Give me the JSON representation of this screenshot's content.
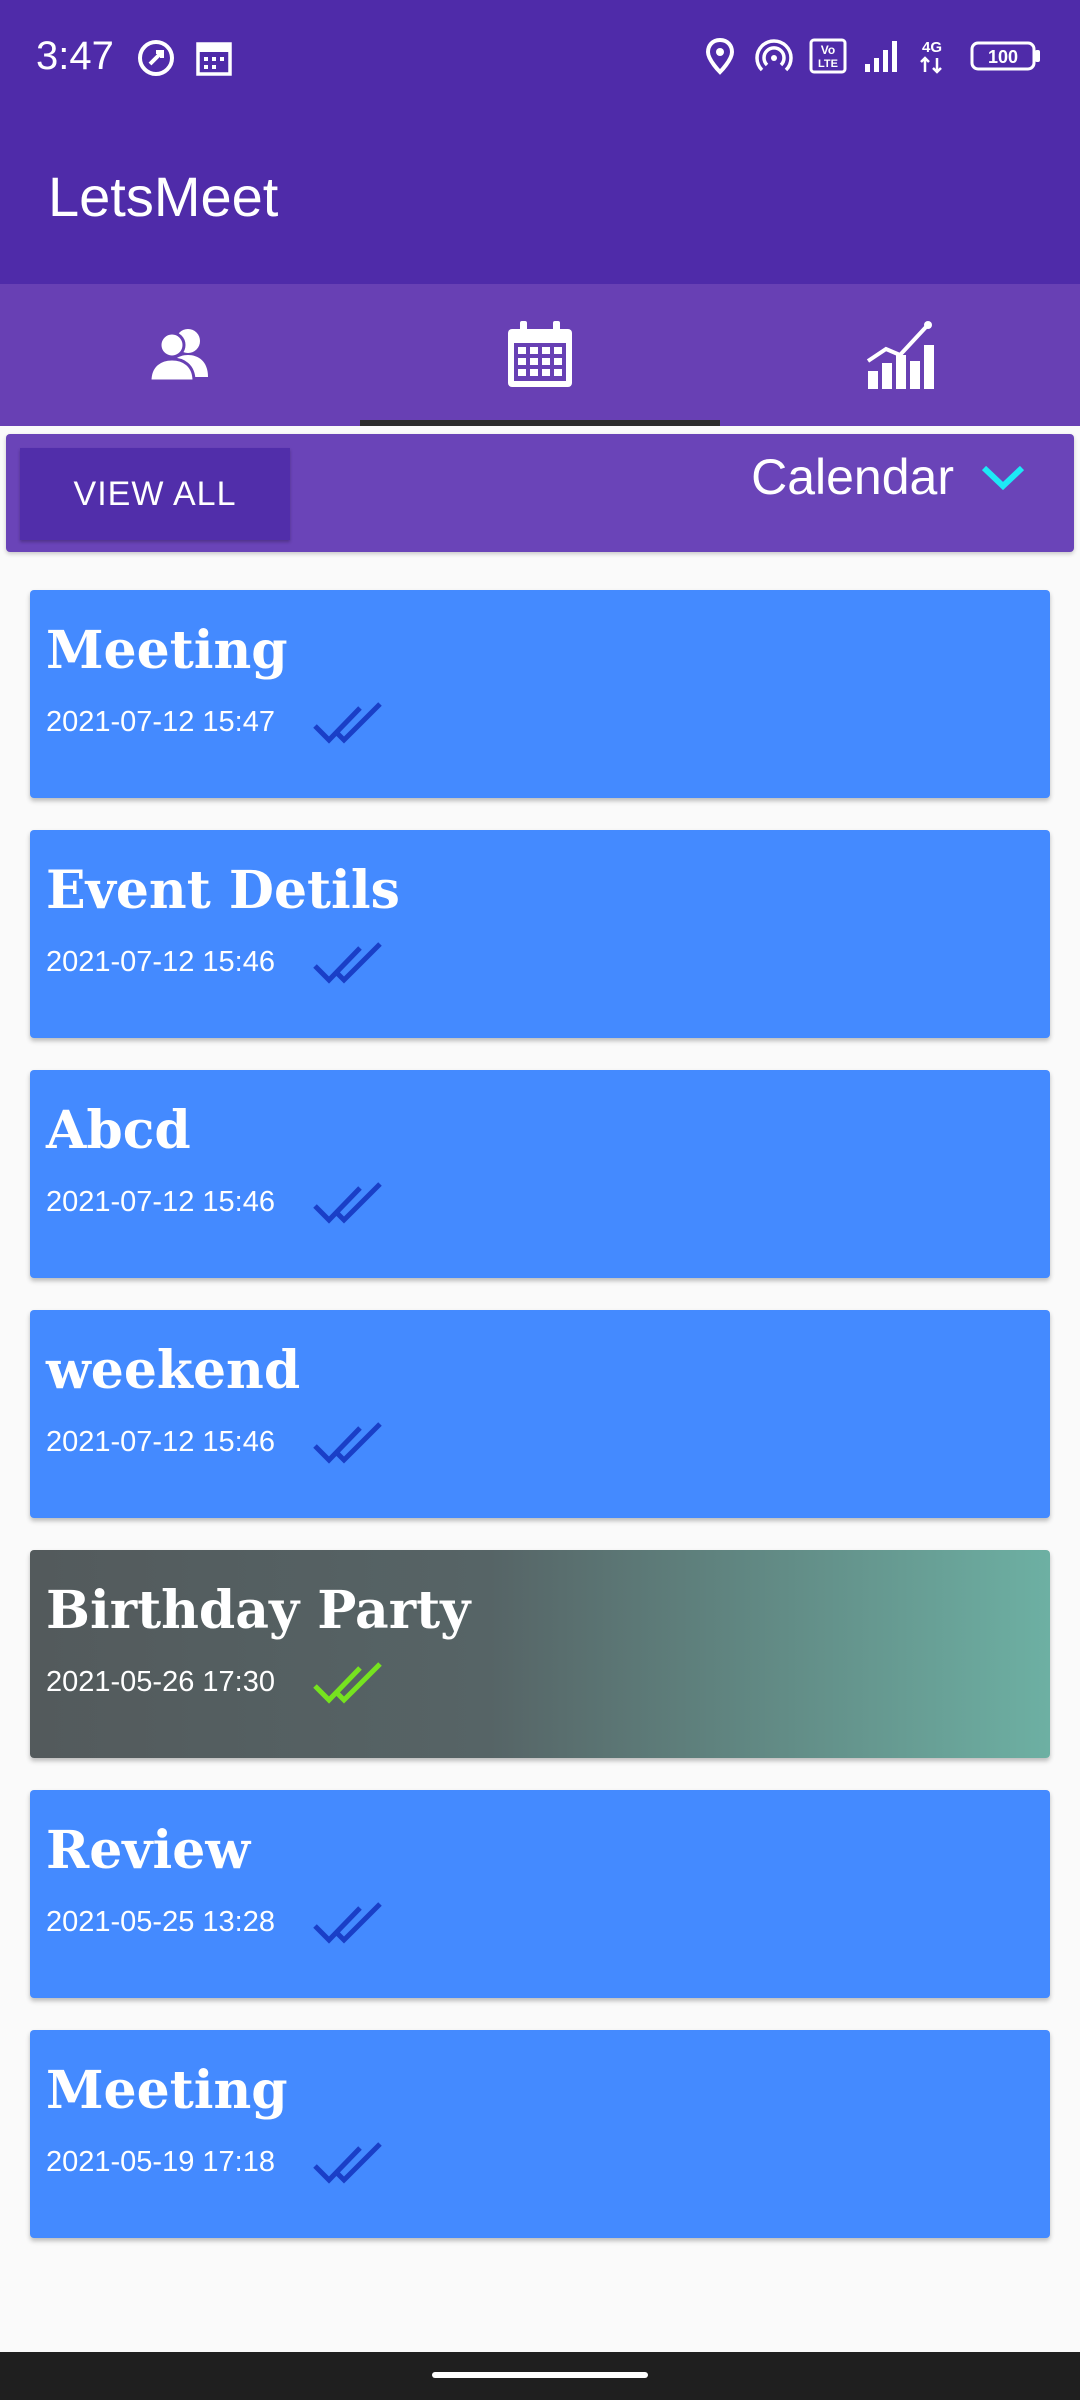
{
  "status_bar": {
    "time": "3:47",
    "left_icons": [
      "vpn-icon",
      "calendar-notification-icon"
    ],
    "right_icons": [
      "location-icon",
      "hotspot-icon",
      "volte-icon",
      "signal-icon",
      "network-4g-icon",
      "battery-icon"
    ],
    "volte_label": "Vo\nLTE",
    "network_label": "4G",
    "battery_level": "100"
  },
  "app_bar": {
    "title": "LetsMeet"
  },
  "tabs": [
    {
      "icon": "group-icon",
      "selected": false
    },
    {
      "icon": "calendar-icon",
      "selected": true
    },
    {
      "icon": "chart-icon",
      "selected": false
    }
  ],
  "filter": {
    "view_all_label": "VIEW ALL",
    "selected_option": "Calendar"
  },
  "events": [
    {
      "title": "Meeting",
      "date": "2021-07-12 15:47",
      "status": "read"
    },
    {
      "title": "Event Detils",
      "date": "2021-07-12 15:46",
      "status": "read"
    },
    {
      "title": "Abcd",
      "date": "2021-07-12 15:46",
      "status": "read"
    },
    {
      "title": "weekend",
      "date": "2021-07-12 15:46",
      "status": "read"
    },
    {
      "title": "Birthday Party",
      "date": "2021-05-26 17:30",
      "status": "done"
    },
    {
      "title": "Review",
      "date": "2021-05-25 13:28",
      "status": "read"
    },
    {
      "title": "Meeting",
      "date": "2021-05-19 17:18",
      "status": "read"
    }
  ],
  "colors": {
    "primary": "#4f2ba9",
    "tab_bar": "#6840b4",
    "card": "#448aff",
    "check_default": "#1a3fc7",
    "check_done": "#76e31f",
    "accent": "#1de9f6"
  }
}
